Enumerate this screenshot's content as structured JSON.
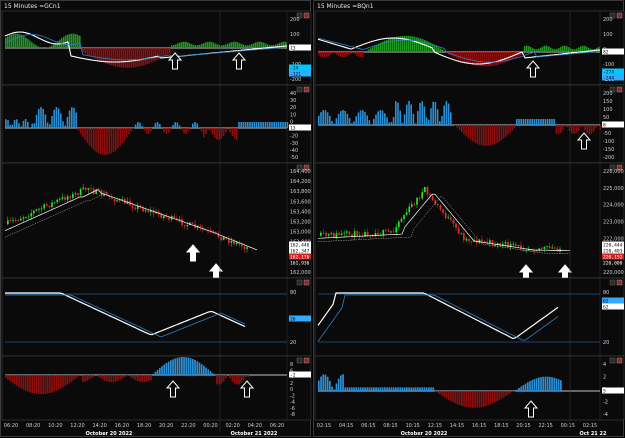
{
  "left": {
    "title": "15 Minutes =GCn1",
    "osc1": {
      "ticks": [
        "200",
        "100",
        "0",
        "-100",
        "-200"
      ],
      "tags": [
        "13",
        "-24",
        "-121"
      ]
    },
    "osc2": {
      "ticks": [
        "40",
        "30",
        "20",
        "10",
        "0",
        "-10",
        "-20",
        "-30",
        "-40",
        "-50"
      ],
      "tags": [
        "13"
      ]
    },
    "price": {
      "ticks": [
        "164,400",
        "164,200",
        "163,800",
        "163,600",
        "163,400",
        "163,200",
        "163,000",
        "162,800",
        "162,600",
        "162,400",
        "162,000"
      ],
      "tags": [
        "162,446",
        "162,347",
        "162,176",
        "161,936"
      ]
    },
    "stoch": {
      "ticks": [
        "80",
        "20"
      ],
      "tags": [
        "26"
      ]
    },
    "hist": {
      "ticks": [
        "8",
        "6",
        "4",
        "2",
        "0",
        "-2",
        "-4",
        "-6",
        "-8"
      ],
      "tags": [
        "-2"
      ]
    },
    "time_labels": [
      "06:20",
      "08:20",
      "10:20",
      "12:20",
      "14:20",
      "16:20",
      "18:20",
      "20:20",
      "22:20",
      "00:20",
      "02:20",
      "04:20",
      "06:20"
    ],
    "date_labels": [
      "October 20 2022",
      "October 21 2022"
    ]
  },
  "right": {
    "title": "15 Minutes =BQn1",
    "osc1": {
      "ticks": [
        "200",
        "100",
        "0",
        "-100",
        "-200"
      ],
      "tags": [
        "82",
        "-274",
        "-244"
      ]
    },
    "osc2": {
      "ticks": [
        "200",
        "150",
        "100",
        "50",
        "0",
        "-50",
        "-100",
        "-150",
        "-200"
      ],
      "tags": [
        "8"
      ]
    },
    "price": {
      "ticks": [
        "226,000",
        "225,000",
        "224,000",
        "223,000",
        "222,000",
        "221,000",
        "220,000"
      ],
      "tags": [
        "220,444",
        "220,403",
        "220,152",
        "220,000"
      ]
    },
    "stoch": {
      "ticks": [
        "80",
        "20"
      ],
      "tags": [
        "62",
        "62"
      ]
    },
    "hist": {
      "ticks": [
        "4",
        "2",
        "0",
        "-2",
        "-4"
      ],
      "tags": [
        "5"
      ]
    },
    "time_labels": [
      "02:15",
      "04:15",
      "06:15",
      "08:15",
      "10:15",
      "12:15",
      "14:15",
      "16:15",
      "18:15",
      "20:15",
      "22:15",
      "00:15",
      "02:15"
    ],
    "date_labels": [
      "October 20 2022",
      "Oct 21 22"
    ]
  }
}
